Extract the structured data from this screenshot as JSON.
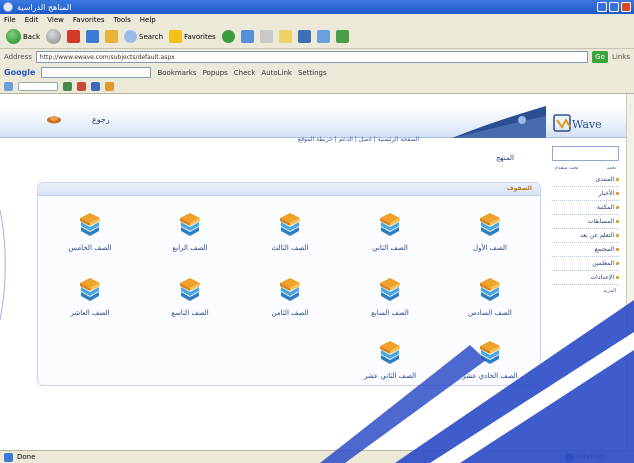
{
  "window": {
    "title": "المناهج الدراسية",
    "colors": {
      "title_bar": "#1f58c8",
      "chrome": "#ece9d8",
      "accent": "#2b4f93",
      "highlight": "#e39a1c"
    }
  },
  "menubar": {
    "items": [
      "File",
      "Edit",
      "View",
      "Favorites",
      "Tools",
      "Help"
    ]
  },
  "toolbar": {
    "back_label": "Back",
    "search_label": "Search",
    "favorites_label": "Favorites"
  },
  "addressbar": {
    "label": "Address",
    "url": "http://www.ewave.com/subjects/default.aspx",
    "go_label": "Go",
    "links_label": "Links"
  },
  "googlebar": {
    "logo": "Google",
    "bookmarks_label": "Bookmarks",
    "popups_label": "Popups",
    "check_label": "Check",
    "autolink_label": "AutoLink",
    "settings_label": "Settings"
  },
  "site": {
    "home_link": "رجوع",
    "header_links": "الصفحة الرئيسية | اتصل | الدعم | خريطة الموقع",
    "logo_text": "Wave",
    "page_heading": "المنهج",
    "panel_title": "الصفوف",
    "grades": [
      {
        "label": "الصف الأول"
      },
      {
        "label": "الصف الثاني"
      },
      {
        "label": "الصف الثالث"
      },
      {
        "label": "الصف الرابع"
      },
      {
        "label": "الصف الخامس"
      },
      {
        "label": "الصف السادس"
      },
      {
        "label": "الصف السابع"
      },
      {
        "label": "الصف الثامن"
      },
      {
        "label": "الصف التاسع"
      },
      {
        "label": "الصف العاشر"
      },
      {
        "label": "الصف الحادي عشر"
      },
      {
        "label": "الصف الثاني عشر"
      }
    ]
  },
  "sidebar": {
    "head_right": "بحث",
    "head_left": "بحث متقدم",
    "items": [
      "المنتدى",
      "الأخبار",
      "المكتبة",
      "المسابقات",
      "التعلم عن بعد",
      "المجتمع",
      "المعلمين",
      "الإعدادات"
    ],
    "footer": "المزيد"
  },
  "statusbar": {
    "status": "Done",
    "zone": "Internet"
  }
}
